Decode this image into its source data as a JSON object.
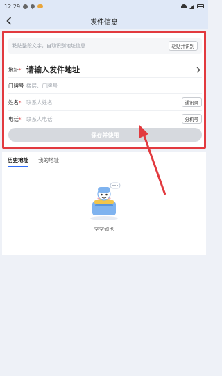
{
  "status_bar": {
    "time": "12:29"
  },
  "header": {
    "title": "发件信息"
  },
  "paste": {
    "placeholder": "粘贴整段文字，自动识别地址信息",
    "button_label": "粘贴并识别"
  },
  "form": {
    "address": {
      "label": "地址",
      "required": "*",
      "value": "请输入发件地址"
    },
    "door": {
      "label": "门牌号",
      "placeholder": "楼层、门牌号"
    },
    "name": {
      "label": "姓名",
      "required": "*",
      "placeholder": "联系人姓名",
      "chip": "通讯录"
    },
    "phone": {
      "label": "电话",
      "required": "*",
      "placeholder": "联系人电话",
      "chip": "分机号"
    },
    "save_label": "保存并使用"
  },
  "tabs": [
    {
      "label": "历史地址"
    },
    {
      "label": "我的地址"
    }
  ],
  "empty_state": {
    "text": "空空如也"
  },
  "colors": {
    "highlight": "#e23a3f",
    "accent": "#2f6df6"
  }
}
